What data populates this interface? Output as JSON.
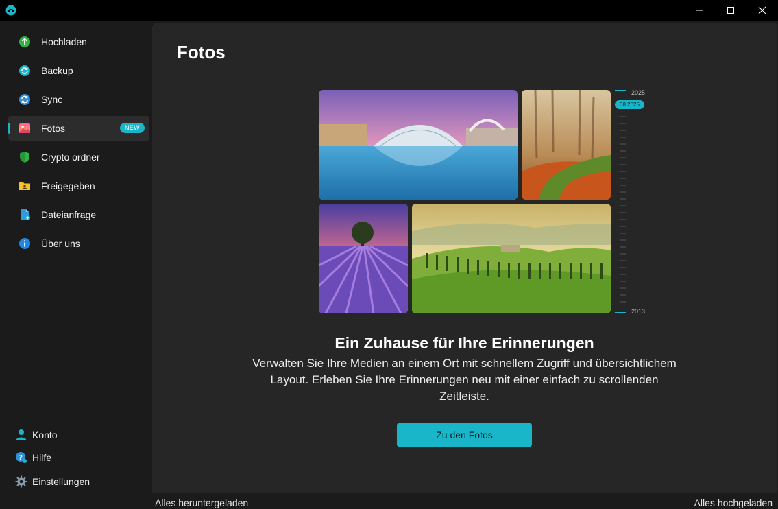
{
  "sidebar": {
    "items": [
      {
        "label": "Hochladen",
        "icon": "upload-icon",
        "color": "#2fb344"
      },
      {
        "label": "Backup",
        "icon": "backup-icon",
        "color": "#19b6c9"
      },
      {
        "label": "Sync",
        "icon": "sync-icon",
        "color": "#2f8fd8"
      },
      {
        "label": "Fotos",
        "icon": "photos-icon",
        "badge": "NEW",
        "active": true
      },
      {
        "label": "Crypto ordner",
        "icon": "shield-icon",
        "color": "#2fb344"
      },
      {
        "label": "Freigegeben",
        "icon": "shared-folder-icon",
        "color": "#f2c230"
      },
      {
        "label": "Dateianfrage",
        "icon": "file-request-icon",
        "color": "#2f9ae0"
      },
      {
        "label": "Über uns",
        "icon": "info-icon",
        "color": "#1e88e5"
      }
    ],
    "bottom": [
      {
        "label": "Konto",
        "icon": "account-icon"
      },
      {
        "label": "Hilfe",
        "icon": "help-icon"
      },
      {
        "label": "Einstellungen",
        "icon": "settings-icon"
      }
    ]
  },
  "main": {
    "title": "Fotos",
    "timeline": {
      "top": "2025",
      "current": "08.2025",
      "bottom": "2013"
    },
    "headline": "Ein Zuhause für Ihre Erinnerungen",
    "description": "Verwalten Sie Ihre Medien an einem Ort mit schnellem Zugriff und übersichtlichem Layout. Erleben Sie Ihre Erinnerungen neu mit einer einfach zu scrollenden Zeitleiste.",
    "cta_label": "Zu den Fotos"
  },
  "status": {
    "left": "Alles heruntergeladen",
    "right": "Alles hochgeladen"
  },
  "colors": {
    "accent": "#19b6c9",
    "background": "#1b1b1b",
    "panel": "#262626"
  }
}
